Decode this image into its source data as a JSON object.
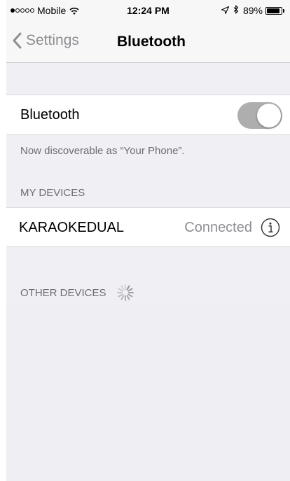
{
  "status_bar": {
    "carrier": "Mobile",
    "signal_bars_filled": 1,
    "signal_bars_total": 5,
    "time": "12:24 PM",
    "battery_percent_label": "89%",
    "battery_level": 0.89,
    "icons": [
      "wifi-icon",
      "location-arrow-icon",
      "bluetooth-icon",
      "battery-icon"
    ]
  },
  "nav": {
    "back_label": "Settings",
    "title": "Bluetooth",
    "back_icon": "chevron-left-icon"
  },
  "bluetooth_toggle": {
    "label": "Bluetooth",
    "state": "on (dimmed)"
  },
  "discoverable_note": "Now discoverable as “Your Phone”.",
  "my_devices": {
    "header": "MY DEVICES",
    "devices": [
      {
        "name": "KARAOKEDUAL",
        "status": "Connected",
        "icon": "info-icon"
      }
    ]
  },
  "other_devices": {
    "header": "OTHER DEVICES",
    "icon": "loading-spinner-icon"
  },
  "colors": {
    "background": "#efeff4",
    "bar_background": "#f7f7f7",
    "secondary_text": "#6d6d72",
    "toggle_track": "#aeaeae",
    "status_text": "#8e8e93"
  }
}
